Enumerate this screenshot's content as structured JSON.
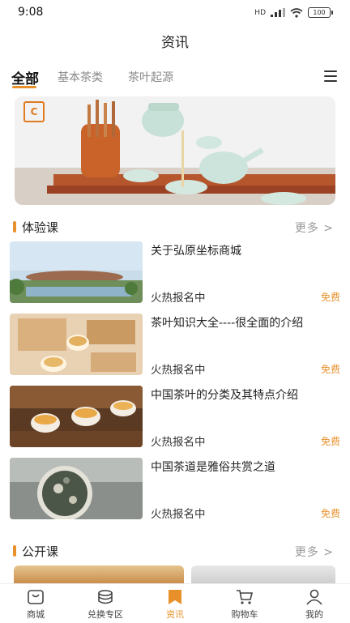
{
  "status_bar": {
    "time": "9:08",
    "network": "HD",
    "battery": "100"
  },
  "header": {
    "title": "资讯"
  },
  "tabs": [
    {
      "label": "全部",
      "active": true
    },
    {
      "label": "基本茶类",
      "active": false
    },
    {
      "label": "茶叶起源",
      "active": false
    }
  ],
  "banner": {
    "logo": "C"
  },
  "sections": {
    "experience": {
      "title": "体验课",
      "more": "更多 >"
    },
    "public": {
      "title": "公开课",
      "more": "更多 >"
    }
  },
  "courses": [
    {
      "title": "关于弘原坐标商城",
      "status": "火热报名中",
      "price": "免费"
    },
    {
      "title": "茶叶知识大全----很全面的介绍",
      "status": "火热报名中",
      "price": "免费"
    },
    {
      "title": "中国茶叶的分类及其特点介绍",
      "status": "火热报名中",
      "price": "免费"
    },
    {
      "title": "中国茶道是雅俗共赏之道",
      "status": "火热报名中",
      "price": "免费"
    }
  ],
  "tabbar": [
    {
      "label": "商城",
      "icon": "shop-icon",
      "active": false
    },
    {
      "label": "兑换专区",
      "icon": "exchange-icon",
      "active": false
    },
    {
      "label": "资讯",
      "icon": "news-icon",
      "active": true
    },
    {
      "label": "购物车",
      "icon": "cart-icon",
      "active": false
    },
    {
      "label": "我的",
      "icon": "profile-icon",
      "active": false
    }
  ],
  "colors": {
    "accent": "#e8912b",
    "text": "#222222",
    "muted": "#999999"
  }
}
